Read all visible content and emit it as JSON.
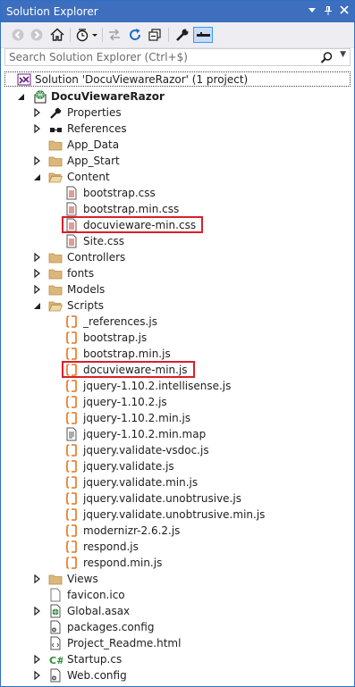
{
  "window": {
    "title": "Solution Explorer",
    "title_bar_bg": "#3d6fbe",
    "highlight_color": "#d8202a"
  },
  "titlebar_buttons": [
    {
      "name": "dropdown-arrow-icon"
    },
    {
      "name": "pin-icon"
    },
    {
      "name": "close-icon"
    }
  ],
  "toolbar": {
    "tools": [
      {
        "name": "back-icon"
      },
      {
        "name": "forward-icon"
      },
      {
        "name": "home-icon"
      },
      {
        "name": "history-icon"
      },
      {
        "name": "sync-icon"
      },
      {
        "name": "refresh-icon"
      },
      {
        "name": "collapse-all-icon"
      },
      {
        "name": "properties-wrench-icon"
      },
      {
        "name": "preview-icon"
      }
    ]
  },
  "search": {
    "placeholder": "Search Solution Explorer (Ctrl+$)"
  },
  "tree": {
    "solution_label": "Solution 'DocuViewareRazor' (1 project)",
    "project_label": "DocuViewareRazor",
    "items": [
      {
        "label": "Properties",
        "icon": "wrench-icon",
        "expander": "closed"
      },
      {
        "label": "References",
        "icon": "references-icon",
        "expander": "closed"
      },
      {
        "label": "App_Data",
        "icon": "folder-icon",
        "expander": "none"
      },
      {
        "label": "App_Start",
        "icon": "folder-icon",
        "expander": "closed"
      },
      {
        "label": "Content",
        "icon": "folder-open-icon",
        "expander": "open"
      },
      {
        "label": "bootstrap.css",
        "icon": "css-file-icon",
        "expander": "none"
      },
      {
        "label": "bootstrap.min.css",
        "icon": "css-file-icon",
        "expander": "none"
      },
      {
        "label": "docuvieware-min.css",
        "icon": "css-file-icon",
        "expander": "none",
        "highlighted": true
      },
      {
        "label": "Site.css",
        "icon": "css-file-icon",
        "expander": "none"
      },
      {
        "label": "Controllers",
        "icon": "folder-icon",
        "expander": "closed"
      },
      {
        "label": "fonts",
        "icon": "folder-icon",
        "expander": "closed"
      },
      {
        "label": "Models",
        "icon": "folder-icon",
        "expander": "closed"
      },
      {
        "label": "Scripts",
        "icon": "folder-open-icon",
        "expander": "open"
      },
      {
        "label": "_references.js",
        "icon": "js-file-icon",
        "expander": "none"
      },
      {
        "label": "bootstrap.js",
        "icon": "js-file-icon",
        "expander": "none"
      },
      {
        "label": "bootstrap.min.js",
        "icon": "js-file-icon",
        "expander": "none"
      },
      {
        "label": "docuvieware-min.js",
        "icon": "js-file-icon",
        "expander": "none",
        "highlighted": true
      },
      {
        "label": "jquery-1.10.2.intellisense.js",
        "icon": "js-file-icon",
        "expander": "none"
      },
      {
        "label": "jquery-1.10.2.js",
        "icon": "js-file-icon",
        "expander": "none"
      },
      {
        "label": "jquery-1.10.2.min.js",
        "icon": "js-file-icon",
        "expander": "none"
      },
      {
        "label": "jquery-1.10.2.min.map",
        "icon": "map-file-icon",
        "expander": "none"
      },
      {
        "label": "jquery.validate-vsdoc.js",
        "icon": "js-file-icon",
        "expander": "none"
      },
      {
        "label": "jquery.validate.js",
        "icon": "js-file-icon",
        "expander": "none"
      },
      {
        "label": "jquery.validate.min.js",
        "icon": "js-file-icon",
        "expander": "none"
      },
      {
        "label": "jquery.validate.unobtrusive.js",
        "icon": "js-file-icon",
        "expander": "none"
      },
      {
        "label": "jquery.validate.unobtrusive.min.js",
        "icon": "js-file-icon",
        "expander": "none"
      },
      {
        "label": "modernizr-2.6.2.js",
        "icon": "js-file-icon",
        "expander": "none"
      },
      {
        "label": "respond.js",
        "icon": "js-file-icon",
        "expander": "none"
      },
      {
        "label": "respond.min.js",
        "icon": "js-file-icon",
        "expander": "none"
      },
      {
        "label": "Views",
        "icon": "folder-icon",
        "expander": "closed"
      },
      {
        "label": "favicon.ico",
        "icon": "ico-file-icon",
        "expander": "none"
      },
      {
        "label": "Global.asax",
        "icon": "asax-file-icon",
        "expander": "closed"
      },
      {
        "label": "packages.config",
        "icon": "config-file-icon",
        "expander": "none"
      },
      {
        "label": "Project_Readme.html",
        "icon": "html-file-icon",
        "expander": "none"
      },
      {
        "label": "Startup.cs",
        "icon": "csharp-file-icon",
        "expander": "closed"
      },
      {
        "label": "Web.config",
        "icon": "config-file-icon",
        "expander": "closed"
      }
    ]
  }
}
